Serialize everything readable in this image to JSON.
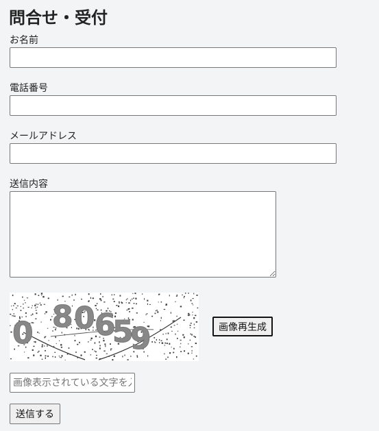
{
  "page": {
    "title": "問合せ・受付"
  },
  "form": {
    "name_label": "お名前",
    "name_value": "",
    "phone_label": "電話番号",
    "phone_value": "",
    "email_label": "メールアドレス",
    "email_value": "",
    "message_label": "送信内容",
    "message_value": ""
  },
  "captcha": {
    "image_text": "0 80659",
    "regenerate_label": "画像再生成",
    "input_placeholder": "画像表示されている文字を入力",
    "input_value": ""
  },
  "submit": {
    "label": "送信する"
  }
}
